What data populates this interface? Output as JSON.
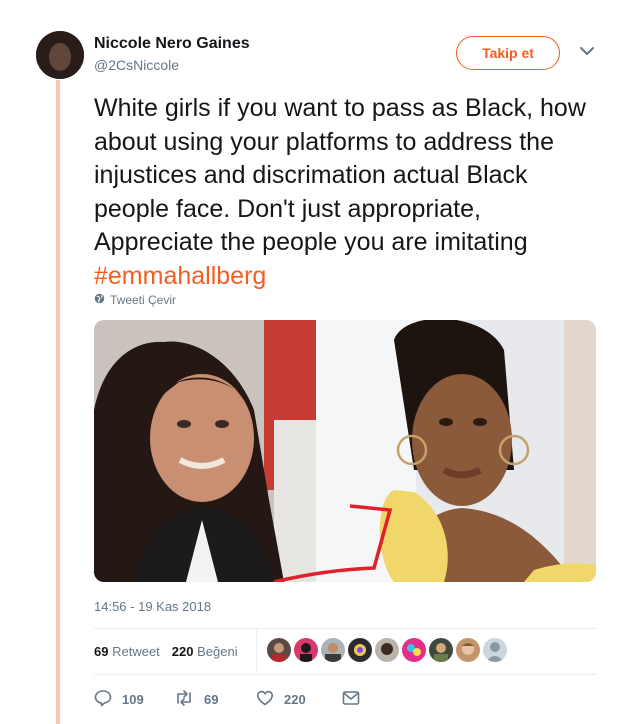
{
  "author": {
    "name": "Niccole Nero Gaines",
    "handle": "@2CsNiccole"
  },
  "follow_button": {
    "label": "Takip et"
  },
  "tweet": {
    "text": "White girls if you want to pass as Black, how about using your platforms to address the injustices and discrimation actual Black people face.  Don't just appropriate, Appreciate the people you are imitating ",
    "hashtag": "#emmahallberg"
  },
  "translate_label": "Tweeti Çevir",
  "timestamp": "14:56 - 19 Kas 2018",
  "stats": {
    "retweet_count": "69",
    "retweet_label": "Retweet",
    "like_count": "220",
    "like_label": "Beğeni"
  },
  "actions": {
    "reply_count": "109",
    "retweet_count": "69",
    "like_count": "220"
  },
  "colors": {
    "accent": "#f45d22",
    "rail": "#fbc6ad",
    "muted": "#657786"
  },
  "icons": [
    "chevron-down-icon",
    "globe-icon",
    "reply-icon",
    "retweet-icon",
    "heart-icon",
    "message-icon"
  ]
}
